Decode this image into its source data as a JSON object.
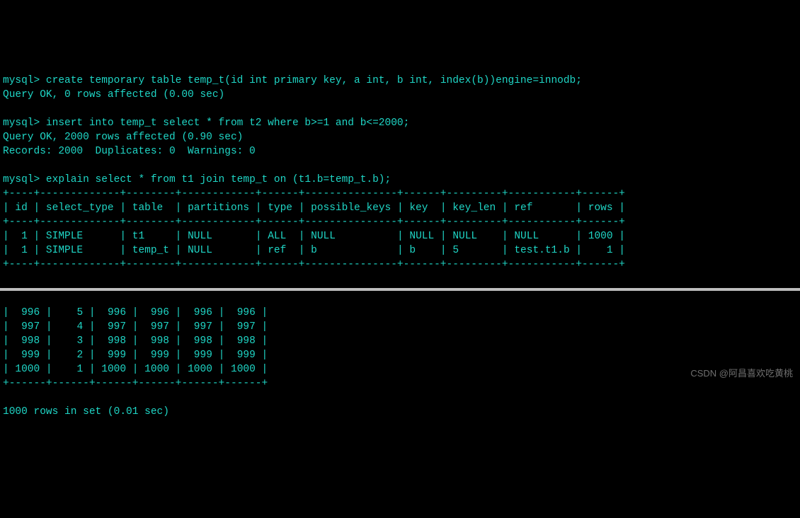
{
  "cmds": {
    "create": {
      "prompt": "mysql>",
      "sql": "create temporary table temp_t(id int primary key, a int, b int, index(b))engine=innodb;",
      "ok": "Query OK, 0 rows affected (0.00 sec)"
    },
    "insert": {
      "prompt": "mysql>",
      "sql": "insert into temp_t select * from t2 where b>=1 and b<=2000;",
      "ok": "Query OK, 2000 rows affected (0.90 sec)",
      "stats": "Records: 2000  Duplicates: 0  Warnings: 0"
    },
    "explain": {
      "prompt": "mysql>",
      "sql": "explain select * from t1 join temp_t on (t1.b=temp_t.b);"
    }
  },
  "explain_table": {
    "headers": [
      "id",
      "select_type",
      "table",
      "partitions",
      "type",
      "possible_keys",
      "key",
      "key_len",
      "ref",
      "rows"
    ],
    "rows": [
      {
        "id": "1",
        "select_type": "SIMPLE",
        "table": "t1",
        "partitions": "NULL",
        "type": "ALL",
        "possible_keys": "NULL",
        "key": "NULL",
        "key_len": "NULL",
        "ref": "NULL",
        "rows": "1000"
      },
      {
        "id": "1",
        "select_type": "SIMPLE",
        "table": "temp_t",
        "partitions": "NULL",
        "type": "ref",
        "possible_keys": "b",
        "key": "b",
        "key_len": "5",
        "ref": "test.t1.b",
        "rows": "1"
      }
    ]
  },
  "result_tail": {
    "rows": [
      [
        "996",
        "5",
        "996",
        "996",
        "996",
        "996"
      ],
      [
        "997",
        "4",
        "997",
        "997",
        "997",
        "997"
      ],
      [
        "998",
        "3",
        "998",
        "998",
        "998",
        "998"
      ],
      [
        "999",
        "2",
        "999",
        "999",
        "999",
        "999"
      ],
      [
        "1000",
        "1",
        "1000",
        "1000",
        "1000",
        "1000"
      ]
    ],
    "footer": "1000 rows in set (0.01 sec)"
  },
  "chart_data": {
    "type": "table",
    "title": "EXPLAIN output",
    "columns": [
      "id",
      "select_type",
      "table",
      "partitions",
      "type",
      "possible_keys",
      "key",
      "key_len",
      "ref",
      "rows"
    ],
    "rows": [
      [
        1,
        "SIMPLE",
        "t1",
        "NULL",
        "ALL",
        "NULL",
        "NULL",
        "NULL",
        "NULL",
        1000
      ],
      [
        1,
        "SIMPLE",
        "temp_t",
        "NULL",
        "ref",
        "b",
        "b",
        5,
        "test.t1.b",
        1
      ]
    ]
  },
  "watermark": "CSDN @阿昌喜欢吃黄桃"
}
